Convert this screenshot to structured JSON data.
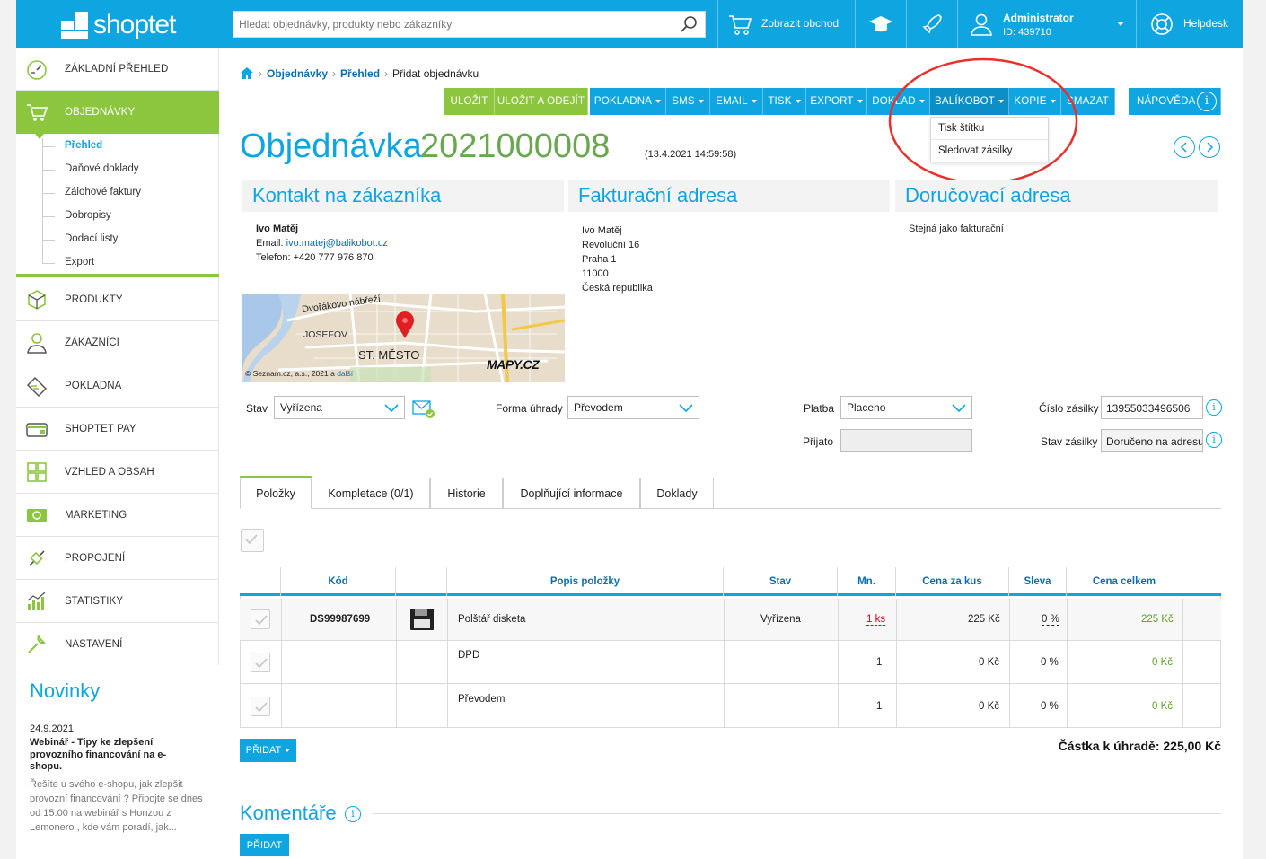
{
  "app": {
    "name": "shoptet"
  },
  "topbar": {
    "search_placeholder": "Hledat objednávky, produkty nebo zákazníky",
    "show_store": "Zobrazit obchod",
    "user_name": "Administrator",
    "user_id": "ID: 439710",
    "helpdesk": "Helpdesk"
  },
  "sidebar": {
    "items": [
      {
        "label": "ZÁKLADNÍ PŘEHLED",
        "icon": "gauge-icon"
      },
      {
        "label": "OBJEDNÁVKY",
        "icon": "cart-icon"
      },
      {
        "label": "PRODUKTY",
        "icon": "box-icon"
      },
      {
        "label": "ZÁKAZNÍCI",
        "icon": "user-icon"
      },
      {
        "label": "POKLADNA",
        "icon": "register-icon"
      },
      {
        "label": "SHOPTET PAY",
        "icon": "wallet-icon"
      },
      {
        "label": "VZHLED A OBSAH",
        "icon": "grid-icon"
      },
      {
        "label": "MARKETING",
        "icon": "money-icon"
      },
      {
        "label": "PROPOJENÍ",
        "icon": "plug-icon"
      },
      {
        "label": "STATISTIKY",
        "icon": "chart-icon"
      },
      {
        "label": "NASTAVENÍ",
        "icon": "wrench-icon"
      }
    ],
    "subitems": [
      {
        "label": "Přehled"
      },
      {
        "label": "Daňové doklady"
      },
      {
        "label": "Zálohové faktury"
      },
      {
        "label": "Dobropisy"
      },
      {
        "label": "Dodací listy"
      },
      {
        "label": "Export"
      }
    ],
    "news": {
      "title": "Novinky",
      "date": "24.9.2021",
      "headline": "Webinář - Tipy ke zlepšení provozního financování na e-shopu.",
      "text": "Řešíte u svého e-shopu, jak zlepšit provozní financování ? Připojte se dnes od 15:00 na webinář s Honzou z Lemonero , kde vám poradí, jak..."
    }
  },
  "breadcrumb": {
    "part1": "Objednávky",
    "part2": "Přehled",
    "current": "Přidat objednávku"
  },
  "toolbar": {
    "save": "ULOŽIT",
    "save_leave": "ULOŽIT A ODEJÍT",
    "pokladna": "POKLADNA",
    "sms": "SMS",
    "email": "EMAIL",
    "tisk": "TISK",
    "export": "EXPORT",
    "doklad": "DOKLAD",
    "balikobot": "BALÍKOBOT",
    "kopie": "KOPIE",
    "smazat": "SMAZAT",
    "napoveda": "NÁPOVĚDA"
  },
  "dropdown": {
    "items": [
      "Tisk štítku",
      "Sledovat zásilky"
    ]
  },
  "order": {
    "title": "Objednávka",
    "number": "2021000008",
    "datetime": "(13.4.2021 14:59:58)"
  },
  "contact": {
    "title": "Kontakt na zákazníka",
    "name": "Ivo Matěj",
    "email_label": "Email:",
    "email": "ivo.matej@balikobot.cz",
    "phone": "Telefon: +420 777 976 870"
  },
  "map": {
    "street": "Dvořákovo nábřeží",
    "district1": "JOSEFOV",
    "district2": "ST. MĚSTO",
    "brand": "MAPY.CZ",
    "copyright": "© Seznam.cz, a.s., 2021 a",
    "more": "další"
  },
  "billing": {
    "title": "Fakturační adresa",
    "lines": [
      "Ivo Matěj",
      "Revoluční 16",
      "Praha 1",
      "11000",
      "Česká republika"
    ]
  },
  "delivery": {
    "title": "Doručovací adresa",
    "text": "Stejná jako fakturační"
  },
  "fields": {
    "stav_label": "Stav",
    "stav_value": "Vyřízena",
    "forma_label": "Forma úhrady",
    "forma_value": "Převodem",
    "platba_label": "Platba",
    "platba_value": "Placeno",
    "prijato_label": "Přijato",
    "prijato_value": "",
    "cislo_label": "Číslo zásilky",
    "cislo_value": "13955033496506",
    "stav_zasilky_label": "Stav zásilky",
    "stav_zasilky_value": "Doručeno na adresu"
  },
  "tabs": [
    "Položky",
    "Kompletace (0/1)",
    "Historie",
    "Doplňující informace",
    "Doklady"
  ],
  "table": {
    "headers": [
      "Kód",
      "Popis položky",
      "Stav",
      "Mn.",
      "Cena za kus",
      "Sleva",
      "Cena celkem"
    ],
    "rows": [
      {
        "code": "DS99987699",
        "desc": "Polštář disketa",
        "status": "Vyřízena",
        "qty": "1 ks",
        "unit": "225 Kč",
        "discount": "0 %",
        "total": "225 Kč"
      },
      {
        "code": "",
        "desc": "DPD",
        "status": "",
        "qty": "1",
        "unit": "0 Kč",
        "discount": "0 %",
        "total": "0 Kč"
      },
      {
        "code": "",
        "desc": "Převodem",
        "status": "",
        "qty": "1",
        "unit": "0 Kč",
        "discount": "0 %",
        "total": "0 Kč"
      }
    ]
  },
  "add_button": "PŘIDAT",
  "total": "Částka k úhradě: 225,00 Kč",
  "comments": {
    "title": "Komentáře",
    "add": "PŘIDAT"
  },
  "colors": {
    "brand_blue": "#0ea5e0",
    "brand_green": "#8cc63f",
    "annotation_red": "#e8312a"
  }
}
